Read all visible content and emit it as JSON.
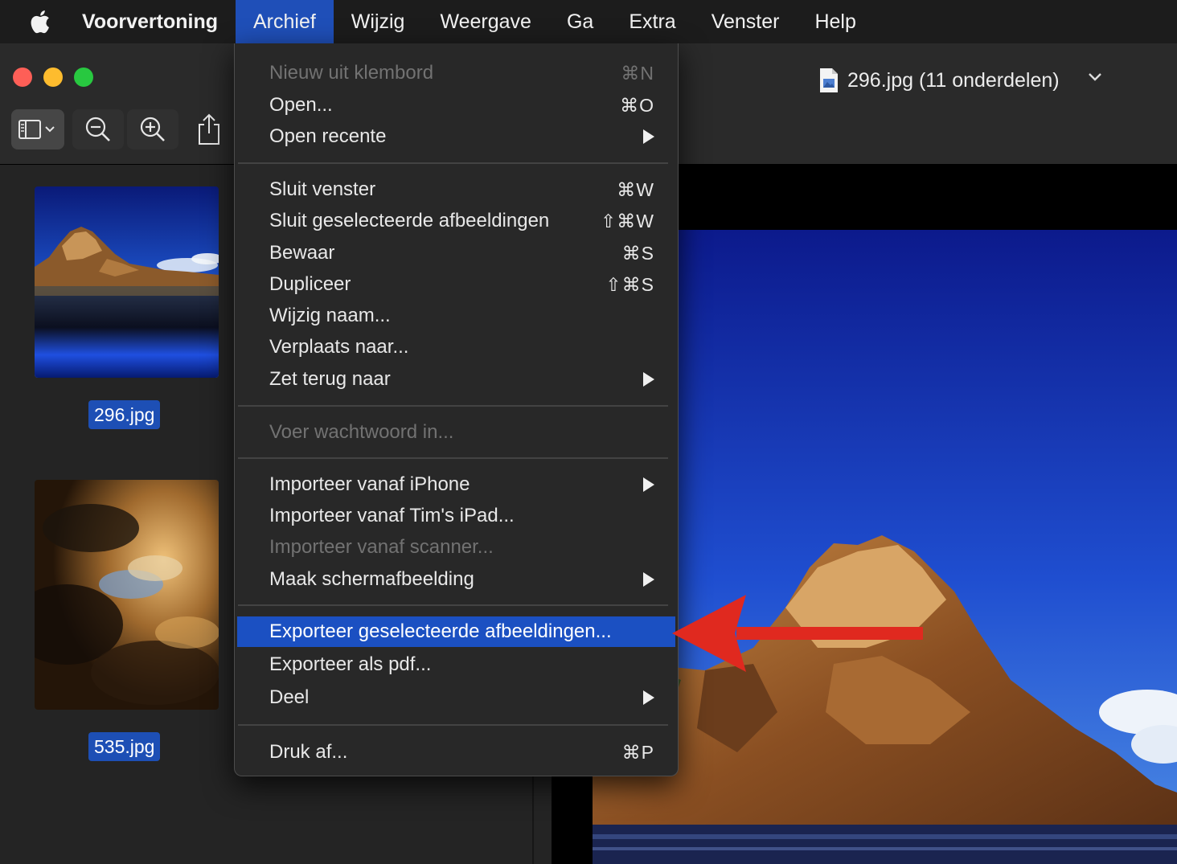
{
  "menubar": {
    "app_name": "Voorvertoning",
    "items": [
      "Archief",
      "Wijzig",
      "Weergave",
      "Ga",
      "Extra",
      "Venster",
      "Help"
    ],
    "active_item": "Archief"
  },
  "window": {
    "title": "296.jpg (11 onderdelen)",
    "icons": {
      "sidebar_toggle": "sidebar-icon",
      "zoom_out": "zoom-out-icon",
      "zoom_in": "zoom-in-icon",
      "share": "share-icon"
    }
  },
  "sidebar": {
    "thumbnails": [
      {
        "label": "296.jpg",
        "selected": true
      },
      {
        "label": "535.jpg",
        "selected": true
      }
    ]
  },
  "menu": {
    "title": "Archief",
    "items": [
      {
        "label": "Nieuw uit klembord",
        "shortcut": "⌘N",
        "disabled": true
      },
      {
        "label": "Open...",
        "shortcut": "⌘O"
      },
      {
        "label": "Open recente",
        "submenu": true
      },
      {
        "label": "Sluit venster",
        "shortcut": "⌘W"
      },
      {
        "label": "Sluit geselecteerde afbeeldingen",
        "shortcut": "⇧⌘W"
      },
      {
        "label": "Bewaar",
        "shortcut": "⌘S"
      },
      {
        "label": "Dupliceer",
        "shortcut": "⇧⌘S"
      },
      {
        "label": "Wijzig naam..."
      },
      {
        "label": "Verplaats naar..."
      },
      {
        "label": "Zet terug naar",
        "submenu": true
      },
      {
        "label": "Voer wachtwoord in...",
        "disabled": true
      },
      {
        "label": "Importeer vanaf iPhone",
        "submenu": true
      },
      {
        "label": "Importeer vanaf Tim's iPad..."
      },
      {
        "label": "Importeer vanaf scanner...",
        "disabled": true
      },
      {
        "label": "Maak schermafbeelding",
        "submenu": true
      },
      {
        "label": "Exporteer geselecteerde afbeeldingen...",
        "highlighted": true
      },
      {
        "label": "Exporteer als pdf..."
      },
      {
        "label": "Deel",
        "submenu": true
      },
      {
        "label": "Druk af...",
        "shortcut": "⌘P"
      }
    ]
  },
  "colors": {
    "menu_highlight": "#1b50c2",
    "selection_label": "#1d4fb5",
    "annotation_arrow": "#e0291f"
  }
}
